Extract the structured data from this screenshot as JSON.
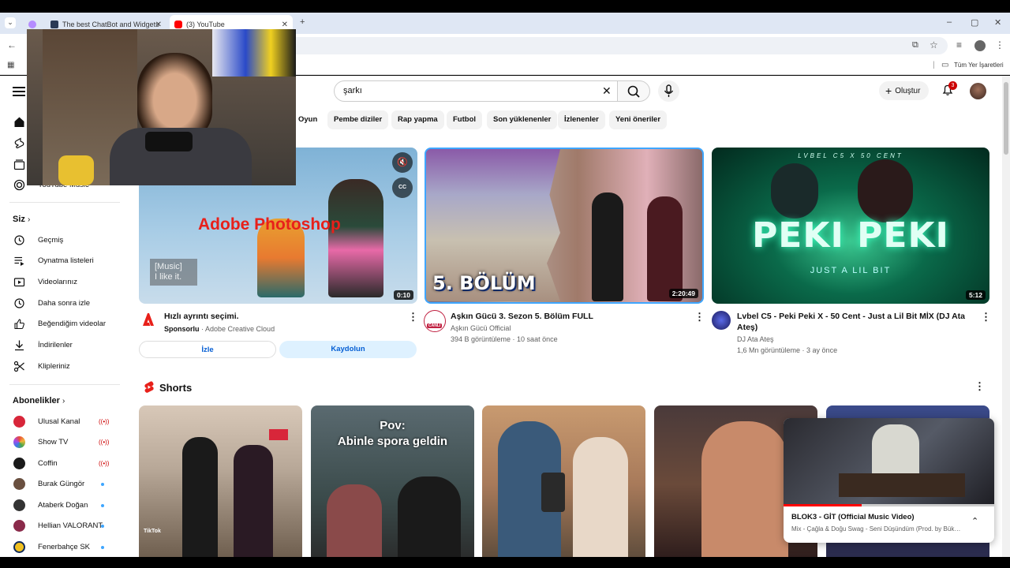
{
  "browser": {
    "tabs": [
      {
        "title": "The best ChatBot and Widgets",
        "active": false
      },
      {
        "title": "(3) YouTube",
        "active": true
      }
    ],
    "new_tab": "+",
    "bookmarks_label": "Tüm Yer İşaretleri"
  },
  "youtube": {
    "search": {
      "query": "şarkı"
    },
    "create_label": "Oluştur",
    "notifications_count": "3",
    "chips": [
      "Oyun",
      "Pembe diziler",
      "Rap yapma",
      "Futbol",
      "Son yüklenenler",
      "İzlenenler",
      "Yeni öneriler"
    ]
  },
  "sidebar": {
    "top_items": [
      {
        "label": "YouTube Music",
        "icon": "youtube-music-icon"
      }
    ],
    "you_section": "Siz",
    "you_items": [
      {
        "label": "Geçmiş",
        "icon": "history-icon"
      },
      {
        "label": "Oynatma listeleri",
        "icon": "playlist-icon"
      },
      {
        "label": "Videolarınız",
        "icon": "your-videos-icon"
      },
      {
        "label": "Daha sonra izle",
        "icon": "watch-later-icon"
      },
      {
        "label": "Beğendiğim videolar",
        "icon": "like-icon"
      },
      {
        "label": "İndirilenler",
        "icon": "download-icon"
      },
      {
        "label": "Klipleriniz",
        "icon": "clips-icon"
      }
    ],
    "subscriptions_section": "Abonelikler",
    "subscriptions": [
      {
        "label": "Ulusal Kanal",
        "status": "live",
        "color": "#d8263a"
      },
      {
        "label": "Show TV",
        "status": "live",
        "color": "#e8a23a"
      },
      {
        "label": "Coffin",
        "status": "live",
        "color": "#1a1a1a"
      },
      {
        "label": "Burak Güngör",
        "status": "new",
        "color": "#6a5040"
      },
      {
        "label": "Ataberk Doğan",
        "status": "new",
        "color": "#333333"
      },
      {
        "label": "Hellian VALORANT",
        "status": "new",
        "color": "#8a2a4a"
      },
      {
        "label": "Fenerbahçe SK",
        "status": "new",
        "color": "#f0c020"
      }
    ]
  },
  "ad": {
    "overlay_title": "Adobe Photoshop",
    "caption": "[Music]\nI like it.",
    "duration": "0:10",
    "title": "Hızlı ayrıntı seçimi.",
    "sponsored": "Sponsorlu",
    "advertiser": "Adobe Creative Cloud",
    "watch_label": "İzle",
    "subscribe_label": "Kaydolun"
  },
  "videos": [
    {
      "thumb_text": "5. BÖLÜM",
      "duration": "2:20:49",
      "title": "Aşkın Gücü 3. Sezon 5. Bölüm FULL",
      "channel": "Aşkın Gücü Official",
      "meta": "394 B görüntüleme · 10 saat önce",
      "live_badge": "CANLI"
    },
    {
      "thumb_text": "PEKI PEKI",
      "thumb_top": "LVBEL C5 X 50 CENT",
      "thumb_bottom": "JUST A LIL BIT",
      "duration": "5:12",
      "title": "Lvbel C5 - Peki Peki X  - 50 Cent - Just a Lil Bit MİX (DJ Ata Ateş)",
      "channel": "DJ Ata Ateş",
      "meta": "1,6 Mn görüntüleme · 3 ay önce"
    }
  ],
  "shorts": {
    "title": "Shorts",
    "items": [
      {
        "overlay": "",
        "watermark": "TikTok"
      },
      {
        "overlay": "Pov:\nAbinle spora geldin",
        "watermark": ""
      },
      {
        "overlay": "",
        "watermark": ""
      },
      {
        "overlay": "",
        "watermark": ""
      },
      {
        "overlay": "",
        "watermark": ""
      }
    ]
  },
  "miniplayer": {
    "title": "BLOK3 - GİT (Official Music Video)",
    "subtitle": "Mix - Çağla & Doğu Swag - Seni Düşündüm (Prod. by Büke...",
    "progress": 0.37
  }
}
